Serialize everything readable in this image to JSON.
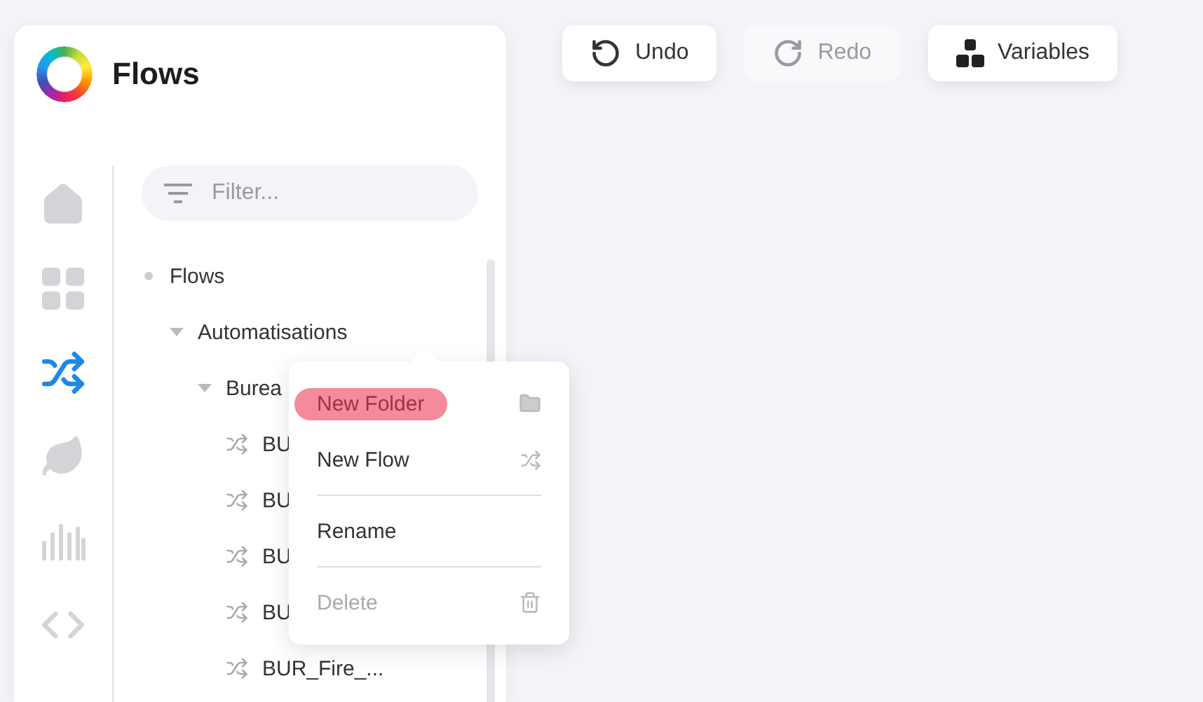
{
  "sidebar": {
    "title": "Flows",
    "nav": [
      {
        "kind": "home",
        "selected": false
      },
      {
        "kind": "grid",
        "selected": false
      },
      {
        "kind": "flows",
        "selected": true
      },
      {
        "kind": "leaf",
        "selected": false
      },
      {
        "kind": "bars",
        "selected": false
      },
      {
        "kind": "code",
        "selected": false
      }
    ],
    "filter": {
      "placeholder": "Filter..."
    },
    "tree": [
      {
        "label": "Flows",
        "kind": "root",
        "children": [
          {
            "label": "Automatisations",
            "kind": "folder",
            "expanded": true,
            "children": [
              {
                "label": "Burea",
                "kind": "folder",
                "expanded": true,
                "children": [
                  {
                    "label": "BU",
                    "kind": "flow"
                  },
                  {
                    "label": "BU",
                    "kind": "flow"
                  },
                  {
                    "label": "BU",
                    "kind": "flow"
                  },
                  {
                    "label": "BU",
                    "kind": "flow"
                  },
                  {
                    "label": "BUR_Fire_...",
                    "kind": "flow"
                  }
                ]
              }
            ]
          }
        ]
      }
    ]
  },
  "toolbar": [
    {
      "label": "Undo",
      "kind": "undo",
      "disabled": false
    },
    {
      "label": "Redo",
      "kind": "redo",
      "disabled": true
    },
    {
      "label": "Variables",
      "kind": "variables",
      "disabled": false
    }
  ],
  "context_menu": [
    {
      "label": "New Folder",
      "kind": "folder",
      "selected": true,
      "disabled": false,
      "divider_after": false
    },
    {
      "label": "New Flow",
      "kind": "flow",
      "selected": false,
      "disabled": false,
      "divider_after": true
    },
    {
      "label": "Rename",
      "kind": "plain",
      "selected": false,
      "disabled": false,
      "divider_after": true
    },
    {
      "label": "Delete",
      "kind": "trash",
      "selected": false,
      "disabled": true,
      "divider_after": false
    }
  ]
}
